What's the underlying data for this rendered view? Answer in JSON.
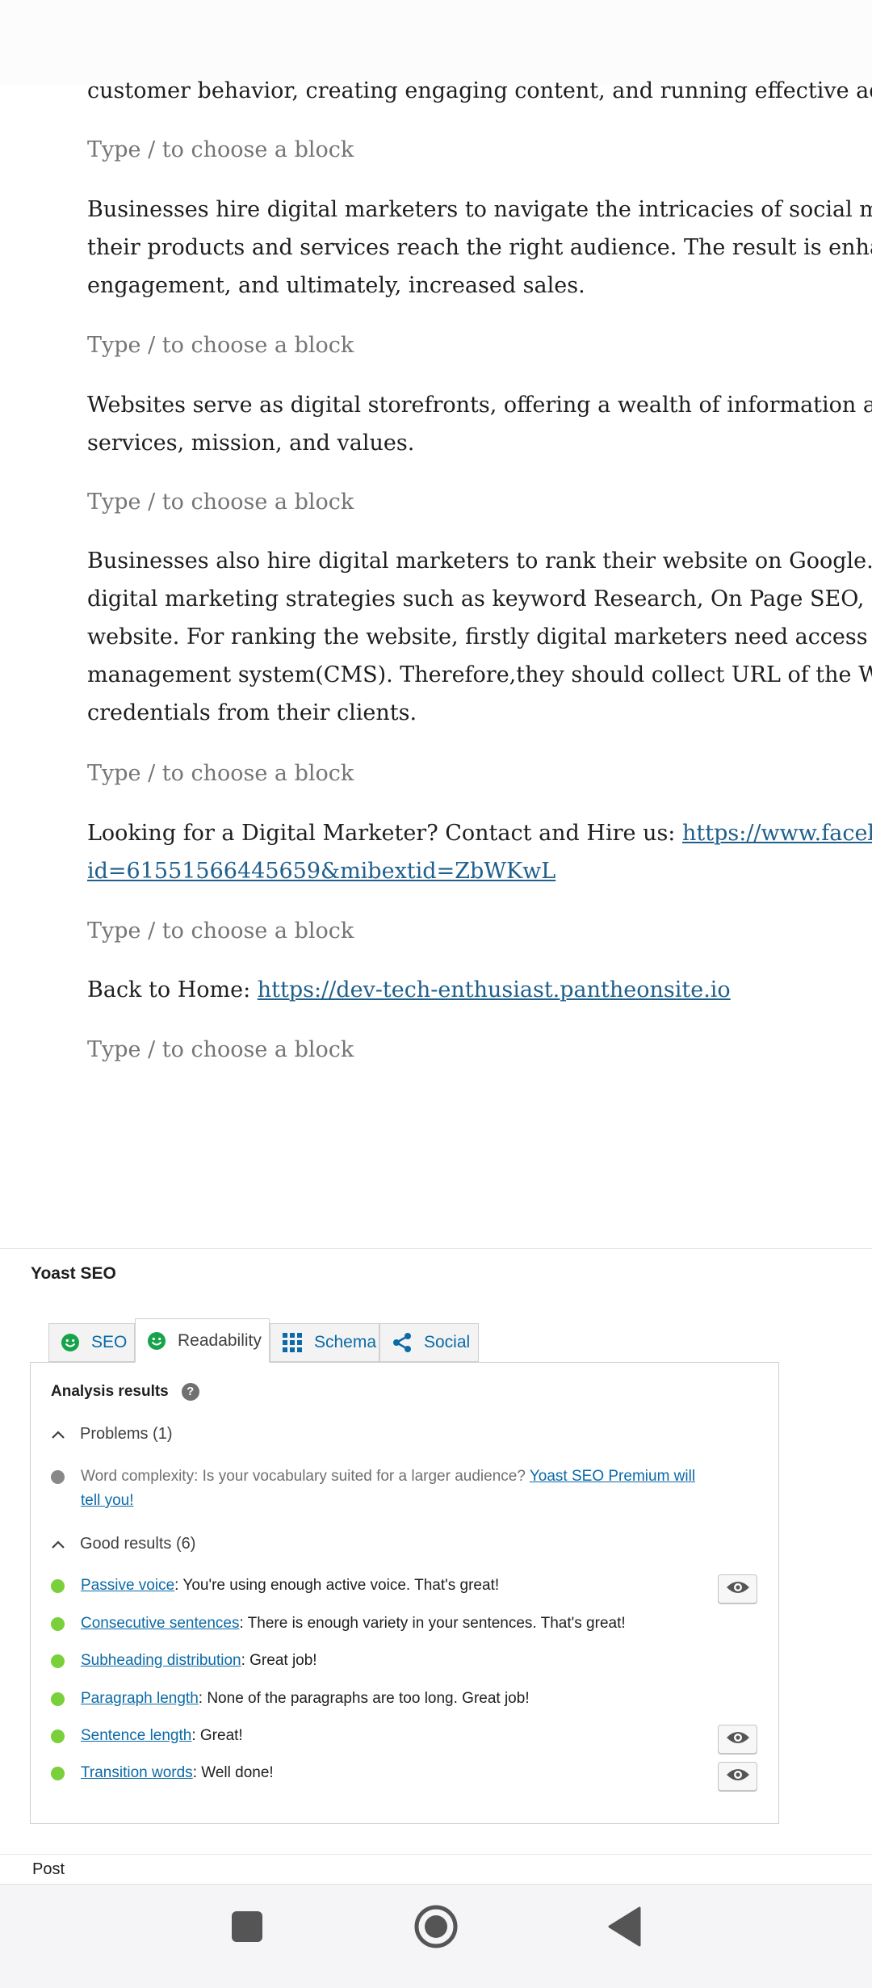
{
  "editor": {
    "blocks": [
      {
        "type": "text",
        "lines": [
          "customer behavior, creating engaging content, and running effective advertis"
        ]
      },
      {
        "type": "placeholder",
        "text": "Type / to choose a block"
      },
      {
        "type": "text",
        "lines": [
          "Businesses hire digital marketers to navigate the intricacies of social media pl",
          "their products and services reach the right audience. The result is enhanced b",
          "engagement, and ultimately, increased sales."
        ]
      },
      {
        "type": "placeholder",
        "text": "Type / to choose a block"
      },
      {
        "type": "text",
        "lines": [
          "Websites serve as digital storefronts, offering a wealth of information about a",
          "services, mission, and values."
        ]
      },
      {
        "type": "placeholder",
        "text": "Type / to choose a block"
      },
      {
        "type": "text",
        "lines": [
          "Businesses also hire digital marketers to rank their website on Google.Digital I",
          "digital marketing strategies such as keyword Research, On Page SEO, Off Page",
          "website. For ranking the website, firstly digital marketers need access to your",
          "management system(CMS). Therefore,they should collect URL of the Website a",
          "credentials from their clients."
        ]
      },
      {
        "type": "placeholder",
        "text": "Type / to choose a block"
      },
      {
        "type": "link",
        "prefix": "Looking for a Digital Marketer? Contact and Hire us: ",
        "link_line1": "https://www.facebook.cor",
        "link_line2": "id=61551566445659&mibextid=ZbWKwL"
      },
      {
        "type": "placeholder",
        "text": "Type / to choose a block"
      },
      {
        "type": "link-single",
        "prefix": "Back to Home: ",
        "link": "https://dev-tech-enthusiast.pantheonsite.io"
      },
      {
        "type": "placeholder",
        "text": "Type / to choose a block"
      }
    ]
  },
  "yoast": {
    "title": "Yoast SEO",
    "tabs": [
      {
        "label": "SEO",
        "icon": "smiley-icon"
      },
      {
        "label": "Readability",
        "icon": "smiley-icon",
        "active": true
      },
      {
        "label": "Schema",
        "icon": "grid-icon"
      },
      {
        "label": "Social",
        "icon": "share-icon"
      }
    ],
    "analysis_heading": "Analysis results",
    "help_glyph": "?",
    "problems_heading": "Problems (1)",
    "problems": [
      {
        "text": "Word complexity: Is your vocabulary suited for a larger audience? ",
        "link": "Yoast SEO Premium will",
        "link2": "tell you!",
        "color": "#888888"
      }
    ],
    "good_heading": "Good results (6)",
    "good": [
      {
        "link": "Passive voice",
        "text": ": You're using enough active voice. That's great!",
        "eye": true
      },
      {
        "link": "Consecutive sentences",
        "text": ": There is enough variety in your sentences. That's great!",
        "eye": false
      },
      {
        "link": "Subheading distribution",
        "text": ": Great job!",
        "eye": false
      },
      {
        "link": "Paragraph length",
        "text": ": None of the paragraphs are too long. Great job!",
        "eye": false
      },
      {
        "link": "Sentence length",
        "text": ": Great!",
        "eye": true
      },
      {
        "link": "Transition words",
        "text": ": Well done!",
        "eye": true
      }
    ],
    "good_color": "#7ad03a",
    "smiley_color": "#16a34a"
  },
  "footer": {
    "post_label": "Post"
  },
  "navbar": {
    "buttons": [
      "square-icon",
      "home-circle-icon",
      "back-triangle-icon"
    ]
  }
}
